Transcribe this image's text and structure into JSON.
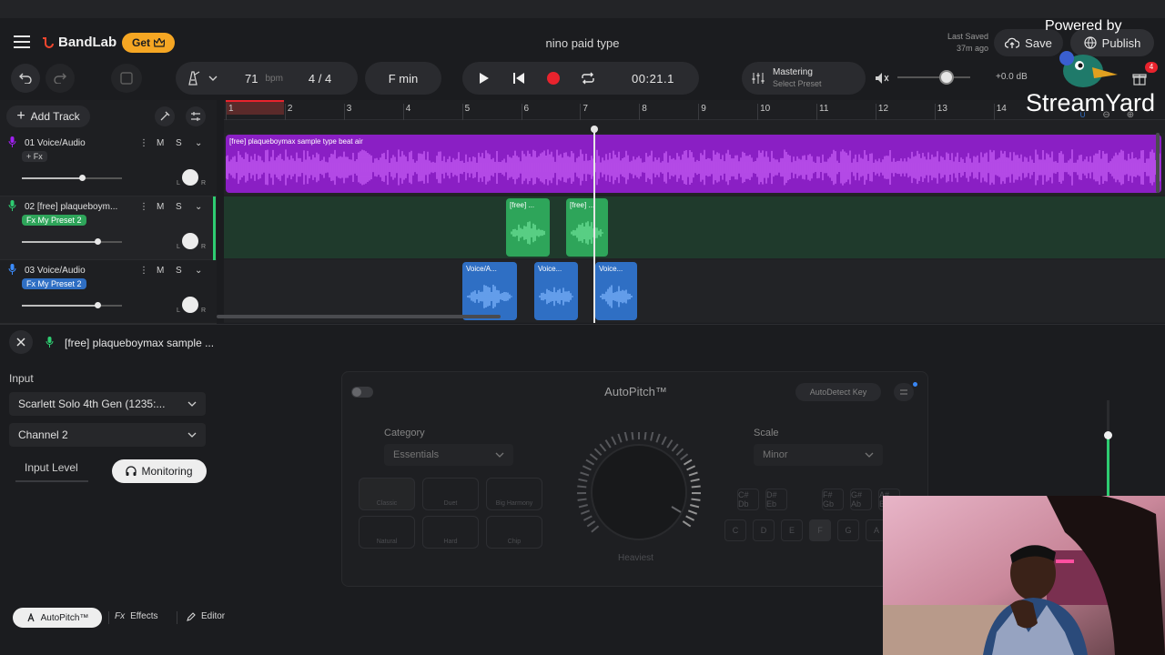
{
  "header": {
    "brand": "BandLab",
    "get_label": "Get",
    "project_title": "nino paid type",
    "last_saved_label": "Last Saved",
    "last_saved_time": "37m ago",
    "save_label": "Save",
    "publish_label": "Publish",
    "gift_badge": "4"
  },
  "toolbar": {
    "bpm_value": "71",
    "bpm_unit": "bpm",
    "time_signature": "4 / 4",
    "key": "F min",
    "time_display": "00:21.1",
    "mastering_title": "Mastering",
    "mastering_preset": "Select Preset",
    "volume_db": "+0.0 dB"
  },
  "tracklist": {
    "add_track_label": "Add Track",
    "mute_label": "M",
    "solo_label": "S",
    "fx_label": "+ Fx",
    "pan_left": "L",
    "pan_right": "R",
    "tracks": [
      {
        "name": "01  Voice/Audio",
        "preset": "",
        "volume": 0.6,
        "color": "#a020f0"
      },
      {
        "name": "02  [free] plaqueboym...",
        "preset": "Fx  My Preset 2",
        "volume": 0.75,
        "color": "#2ecc71"
      },
      {
        "name": "03  Voice/Audio",
        "preset": "Fx  My Preset 2",
        "volume": 0.75,
        "color": "#2f7fd6"
      }
    ]
  },
  "ruler": {
    "marks": [
      "1",
      "2",
      "3",
      "4",
      "5",
      "6",
      "7",
      "8",
      "9",
      "10",
      "11",
      "12",
      "13",
      "14"
    ]
  },
  "clips": {
    "lane1_label": "[free] plaqueboymax sample type beat air",
    "lane2": [
      "[free] ...",
      "[free] ..."
    ],
    "lane3": [
      "Voice/A...",
      "Voice...",
      "Voice..."
    ]
  },
  "bottom": {
    "selected_track": "[free] plaqueboymax sample ...",
    "input_label": "Input",
    "input_device": "Scarlett Solo 4th Gen (1235:...",
    "channel": "Channel 2",
    "input_level_label": "Input Level",
    "monitoring_label": "Monitoring",
    "autopitch_title": "AutoPitch™",
    "autodetect_label": "AutoDetect Key",
    "category_label": "Category",
    "category_value": "Essentials",
    "scale_label": "Scale",
    "scale_value": "Minor",
    "knob_label": "Heaviest",
    "styles": [
      "Classic",
      "Duet",
      "Big Harmony",
      "Natural",
      "Hard",
      "Chip"
    ],
    "keys_flat": [
      "C# Db",
      "D# Eb",
      "F# Gb",
      "G# Ab",
      "A# Bb"
    ],
    "keys_natural": [
      "C",
      "D",
      "E",
      "F",
      "G",
      "A"
    ],
    "tabs": [
      "AutoPitch™",
      "Effects",
      "Editor"
    ]
  },
  "overlay": {
    "powered_by": "Powered by",
    "streamyard": "StreamYard"
  },
  "colors": {
    "brand_red": "#f2462e",
    "get_yellow": "#f5a623",
    "purple_clip": "#a020f0",
    "green_clip": "#2ea55a",
    "blue_clip": "#2f6fc4",
    "record_red": "#e8232d"
  }
}
